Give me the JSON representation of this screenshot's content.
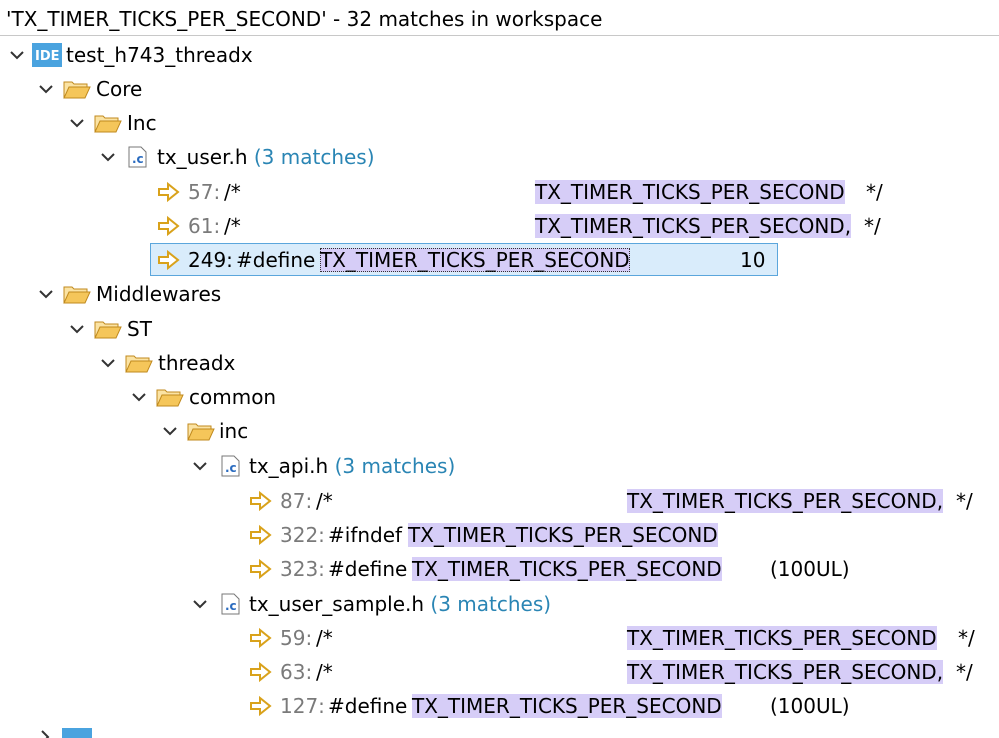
{
  "header": {
    "title": "'TX_TIMER_TICKS_PER_SECOND' - 32 matches in workspace"
  },
  "colors": {
    "highlight": "#d6cdf7",
    "selection": "#d9ecfb",
    "count": "#2a85b4",
    "folder": "#e8b64a"
  },
  "tree": {
    "project": {
      "name": "test_h743_threadx",
      "icon": "ide-project-icon"
    },
    "core": "Core",
    "inc": "Inc",
    "tx_user": {
      "name": "tx_user.h",
      "count": "(3 matches)"
    },
    "m57": {
      "line": "57:",
      "pre": "/*",
      "match": "TX_TIMER_TICKS_PER_SECOND",
      "post": "*/"
    },
    "m61": {
      "line": "61:",
      "pre": "/*",
      "match": "TX_TIMER_TICKS_PER_SECOND,",
      "post": "*/"
    },
    "m249": {
      "line": "249:",
      "pre": "#define",
      "match": "TX_TIMER_TICKS_PER_SECOND",
      "post": "10"
    },
    "middlewares": "Middlewares",
    "st": "ST",
    "threadx": "threadx",
    "common": "common",
    "inc2": "inc",
    "tx_api": {
      "name": "tx_api.h",
      "count": "(3 matches)"
    },
    "m87": {
      "line": "87:",
      "pre": "/*",
      "match": "TX_TIMER_TICKS_PER_SECOND,",
      "post": "*/"
    },
    "m322": {
      "line": "322:",
      "pre": "#ifndef",
      "match": "TX_TIMER_TICKS_PER_SECOND"
    },
    "m323": {
      "line": "323:",
      "pre": "#define",
      "match": "TX_TIMER_TICKS_PER_SECOND",
      "post": "(100UL)"
    },
    "tx_user_sample": {
      "name": "tx_user_sample.h",
      "count": "(3 matches)"
    },
    "m59": {
      "line": "59:",
      "pre": "/*",
      "match": "TX_TIMER_TICKS_PER_SECOND",
      "post": "*/"
    },
    "m63": {
      "line": "63:",
      "pre": "/*",
      "match": "TX_TIMER_TICKS_PER_SECOND,",
      "post": "*/"
    },
    "m127": {
      "line": "127:",
      "pre": "#define",
      "match": "TX_TIMER_TICKS_PER_SECOND",
      "post": "(100UL)"
    }
  }
}
